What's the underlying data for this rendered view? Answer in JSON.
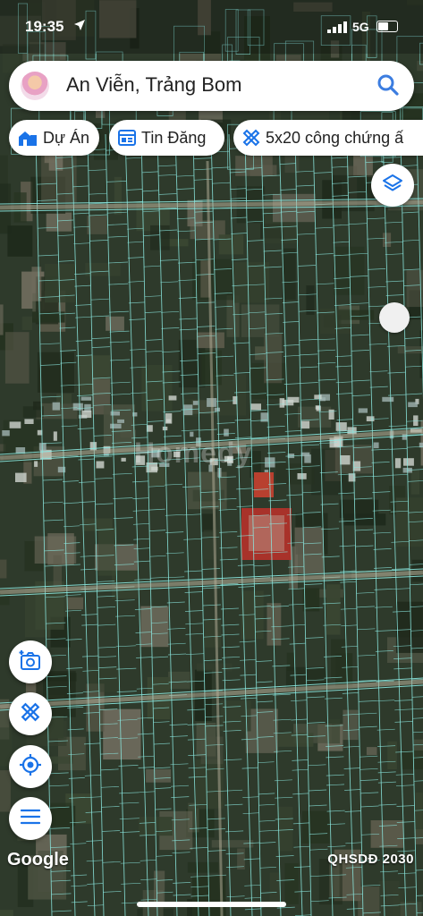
{
  "status_bar": {
    "time": "19:35",
    "network": "5G",
    "battery_level": 0.55
  },
  "search": {
    "query": "An Viễn, Trảng Bom"
  },
  "chips": [
    {
      "label": "Dự Án",
      "icon": "home-building-icon"
    },
    {
      "label": "Tin Đăng",
      "icon": "listing-card-icon"
    },
    {
      "label": "5x20 công chứng ấ",
      "icon": "ruler-pencil-icon"
    }
  ],
  "map": {
    "watermark": "Homedy",
    "attribution": "Google",
    "layer_label": "QHSDĐ 2030"
  },
  "colors": {
    "parcel_line": "#8be8e0",
    "road": "#b8b29c",
    "accent": "#1a73e8",
    "search_icon": "#3c7de0"
  }
}
